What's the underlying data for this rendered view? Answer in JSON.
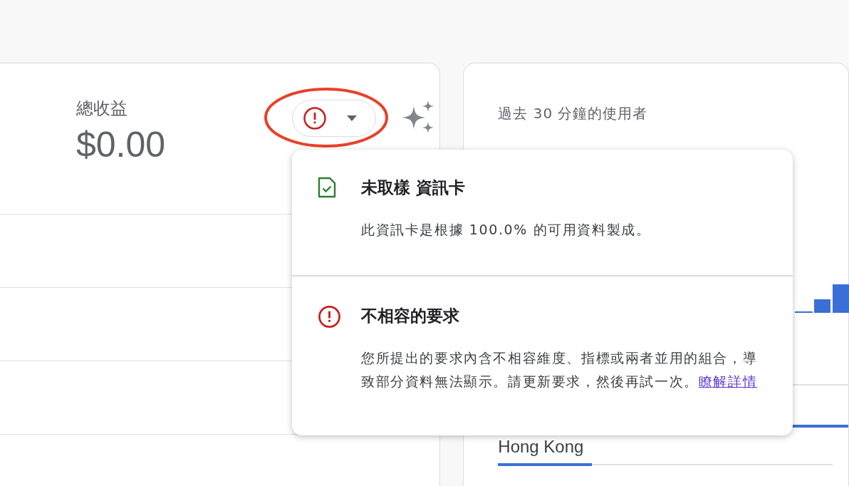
{
  "revenue_card": {
    "title": "總收益",
    "value": "$0.00",
    "status_chip": {
      "kind": "error",
      "expanded": true
    },
    "highlighted": true
  },
  "users_card": {
    "title": "過去 30 分鐘的使用者",
    "countries": [
      {
        "name": "Hong Kong",
        "level": 0.28
      }
    ]
  },
  "popover": {
    "items": [
      {
        "kind": "unsampled",
        "title": "未取樣 資訊卡",
        "body": "此資訊卡是根據 100.0% 的可用資料製成。"
      },
      {
        "kind": "error",
        "title": "不相容的要求",
        "body": "您所提出的要求內含不相容維度、指標或兩者並用的組合，導致部分資料無法顯示。請更新要求，然後再試一次。",
        "link": "瞭解詳情"
      }
    ]
  }
}
